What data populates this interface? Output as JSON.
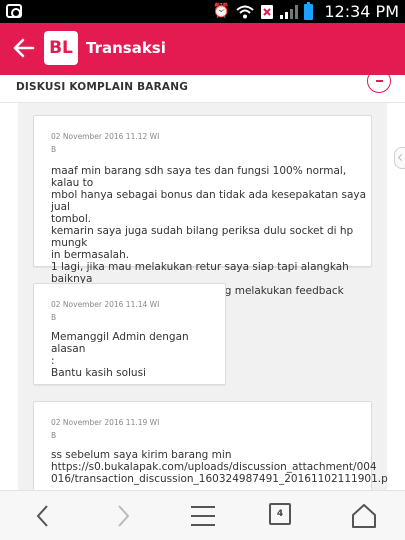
{
  "status_bar": {
    "time": "12:34 PM"
  },
  "header": {
    "logo_text": "BL",
    "title": "Transaksi"
  },
  "section": {
    "title": "DISKUSI KOMPLAIN BARANG"
  },
  "messages": [
    {
      "timestamp": "02 November 2016 11.12 WI",
      "sender": "B",
      "text": "maaf min barang sdh saya tes dan fungsi 100% normal, kalau to\nmbol hanya sebagai bonus dan tidak ada kesepakatan saya jual\ntombol.\nkemarin saya juga sudah bilang periksa dulu socket di hp mungk\nin bermasalah.\n1 lagi, jika mau melakukan retur saya siap tapi alangkah baiknya\njika inbox dulu dan tidak langsung melakukan feedback negatif"
    },
    {
      "timestamp": "02 November 2016 11.14 WI",
      "sender": "B",
      "text": "Memanggil Admin dengan alasan\n:\nBantu kasih solusi"
    },
    {
      "timestamp": "02 November 2016 11.19 WI",
      "sender": "B",
      "text": "ss sebelum saya kirim barang min\nhttps://s0.bukalapak.com/uploads/discussion_attachment/004\n016/transaction_discussion_160324987491_20161102111901.p"
    }
  ],
  "browser_nav": {
    "tab_count": "4"
  },
  "colors": {
    "brand": "#e31b50",
    "panel_bg": "#f1f1f1"
  }
}
